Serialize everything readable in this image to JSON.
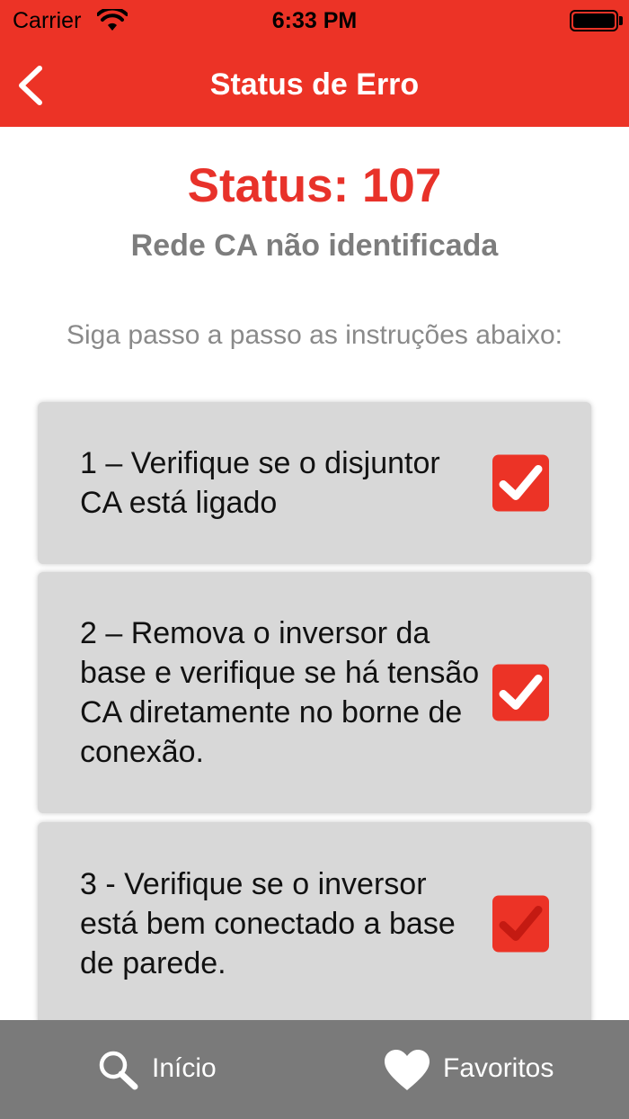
{
  "status_bar": {
    "carrier": "Carrier",
    "time": "6:33 PM",
    "icons": [
      "wifi-icon",
      "battery-icon"
    ]
  },
  "nav": {
    "title": "Status de Erro",
    "back_icon": "chevron-left-icon"
  },
  "status": {
    "code": "Status: 107",
    "description": "Rede CA não identificada"
  },
  "instructions": "Siga passo a passo as instruções abaixo:",
  "steps": [
    {
      "text": "1 – Verifique se o disjuntor CA está ligado",
      "checked": true
    },
    {
      "text": "2 – Remova o inversor da base e verifique se há tensão CA diretamente no borne de conexão.",
      "checked": true
    },
    {
      "text": "3 - Verifique se o inversor está bem conectado a base de parede.",
      "checked": true
    }
  ],
  "tabbar": {
    "home_label": "Início",
    "home_icon": "search-icon",
    "favorites_label": "Favoritos",
    "favorites_icon": "heart-icon"
  },
  "colors": {
    "accent": "#ec3326",
    "card": "#d8d8d8",
    "tabbar": "#7a7a7a",
    "secondary_text": "#7d7d7d"
  }
}
